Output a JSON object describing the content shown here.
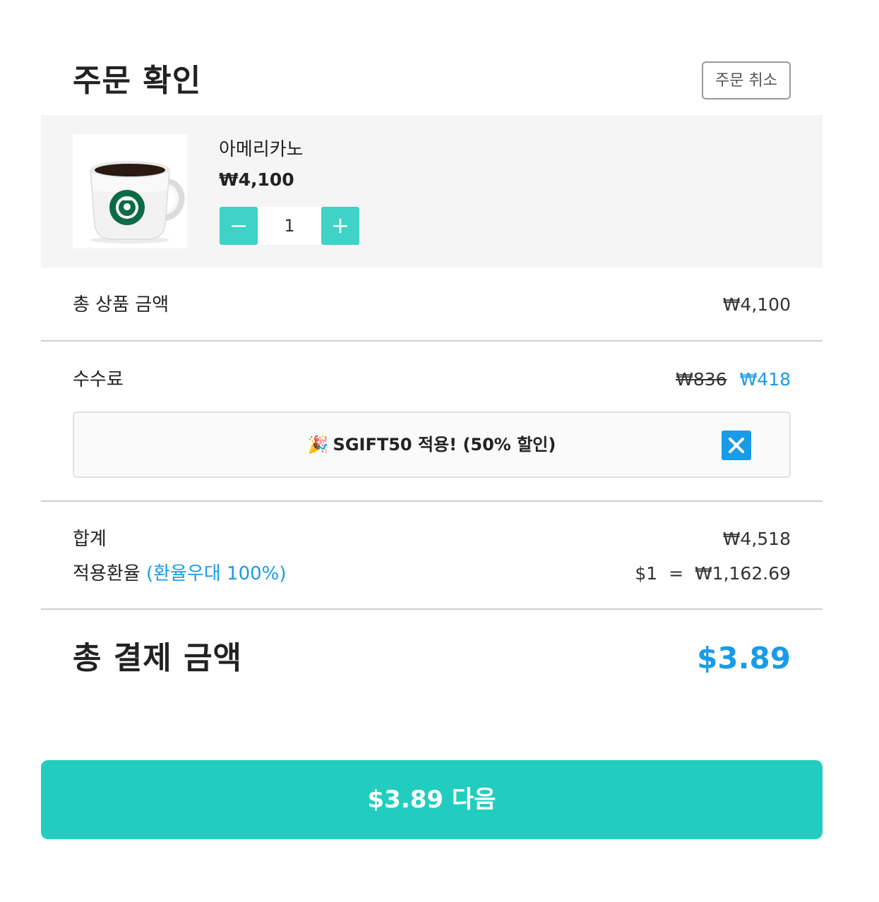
{
  "header": {
    "title": "주문 확인",
    "cancel_label": "주문 취소"
  },
  "item": {
    "name": "아메리카노",
    "price": "₩4,100",
    "quantity": "1",
    "image": "starbucks-mug-coffee"
  },
  "summary": {
    "subtotal_label": "총 상품 금액",
    "subtotal_value": "₩4,100",
    "fee_label": "수수료",
    "fee_original": "₩836",
    "fee_discounted": "₩418",
    "coupon_icon": "🎉",
    "coupon_text": "SGIFT50 적용! (50% 할인)",
    "sum_label": "합계",
    "sum_value": "₩4,518",
    "rate_label": "적용환율",
    "rate_note": "(환율우대 100%)",
    "rate_value": "$1  =  ₩1,162.69"
  },
  "total": {
    "label": "총 결제 금액",
    "value": "$3.89"
  },
  "cta": {
    "label": "$3.89 다음"
  },
  "colors": {
    "accent_teal": "#22cdc0",
    "accent_blue": "#1a9be8",
    "card_bg": "#f5f5f5"
  }
}
